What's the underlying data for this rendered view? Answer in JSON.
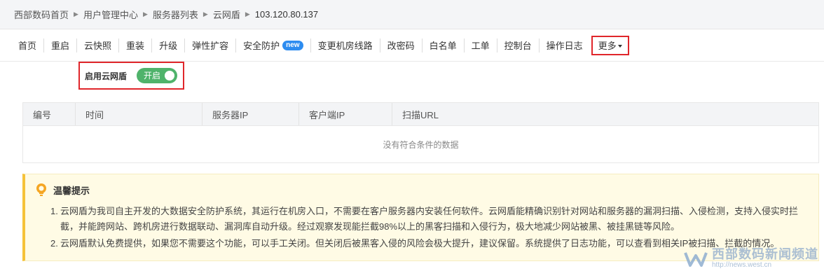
{
  "breadcrumb": [
    "西部数码首页",
    "用户管理中心",
    "服务器列表",
    "云网盾",
    "103.120.80.137"
  ],
  "nav": {
    "items": [
      "首页",
      "重启",
      "云快照",
      "重装",
      "升级",
      "弹性扩容",
      "安全防护",
      "变更机房线路",
      "改密码",
      "白名单",
      "工单",
      "控制台",
      "操作日志"
    ],
    "new_badge": "new",
    "more_label": "更多"
  },
  "shield_toggle": {
    "label": "启用云网盾",
    "state_text": "开启",
    "enabled": true
  },
  "table": {
    "columns": [
      "编号",
      "时间",
      "服务器IP",
      "客户端IP",
      "扫描URL"
    ],
    "empty_text": "没有符合条件的数据"
  },
  "tips": {
    "title": "温馨提示",
    "items": [
      {
        "num": "1.",
        "text": "云网盾为我司自主开发的大数据安全防护系统，其运行在机房入口，不需要在客户服务器内安装任何软件。云网盾能精确识别针对网站和服务器的漏洞扫描、入侵检测，支持入侵实时拦截，并能跨网站、跨机房进行数据联动、漏洞库自动升级。经过观察发现能拦截98%以上的黑客扫描和入侵行为，极大地减少网站被黑、被挂黑链等风险。"
      },
      {
        "num": "2.",
        "text": "云网盾默认免费提供，如果您不需要这个功能，可以手工关闭。但关闭后被黑客入侵的风险会极大提升，建议保留。系统提供了日志功能，可以查看到相关IP被扫描、拦截的情况。"
      }
    ]
  },
  "watermark": {
    "title": "西部数码新闻频道",
    "url": "http://news.west.cn"
  },
  "colors": {
    "accent_red": "#e0262b",
    "toggle_green": "#4fb36b",
    "badge_blue": "#2d8cf0",
    "tip_yellow": "#f5c23a"
  }
}
